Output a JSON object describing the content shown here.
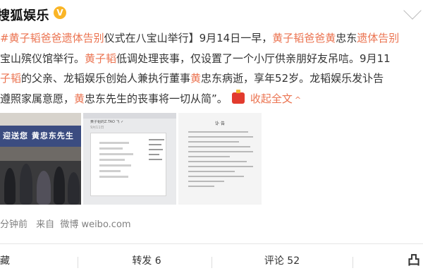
{
  "header": {
    "author": "搜狐娱乐",
    "verified_mark": "V"
  },
  "post": {
    "lines": [
      [
        {
          "t": "#黄子韬爸爸遗体告别",
          "h": true
        },
        {
          "t": "仪式在八宝山举行】9月14日一早，",
          "h": false
        },
        {
          "t": "黄子韬爸爸黄",
          "h": true
        },
        {
          "t": "忠东",
          "h": false
        },
        {
          "t": "遗体告别",
          "h": true
        }
      ],
      [
        {
          "t": "宝山殡仪馆举行。",
          "h": false
        },
        {
          "t": "黄子韬",
          "h": true
        },
        {
          "t": "低调处理丧事，仅设置了一个小厅供亲朋好友吊唁。9月11",
          "h": false
        }
      ],
      [
        {
          "t": "子韬",
          "h": true
        },
        {
          "t": "的父亲、龙韬娱乐创始人兼执行董事",
          "h": false
        },
        {
          "t": "黄",
          "h": true
        },
        {
          "t": "忠东病逝，享年52岁。龙韬娱乐发讣告",
          "h": false
        }
      ],
      [
        {
          "t": "遵照家属意愿，",
          "h": false
        },
        {
          "t": "黄",
          "h": true
        },
        {
          "t": "忠东先生的丧事将一切从简”。",
          "h": false
        }
      ]
    ],
    "expand_label": "收起全文",
    "expand_arrow": "^"
  },
  "images": {
    "photo_sign": "迎送您 黄忠东先生",
    "screenshot_title": "黄子韬的Z.TAO 飞 ✓",
    "screenshot_sub": "9月11日",
    "doc_title": "讣 告"
  },
  "meta": {
    "time": "分钟前",
    "source_prefix": "来自",
    "source": "微博 weibo.com"
  },
  "actions": {
    "favorite": "藏",
    "repost": "转发 6",
    "comment": "评论 52",
    "like": "凸"
  },
  "colors": {
    "highlight": "#eb7350",
    "text": "#333333",
    "meta": "#808080"
  }
}
